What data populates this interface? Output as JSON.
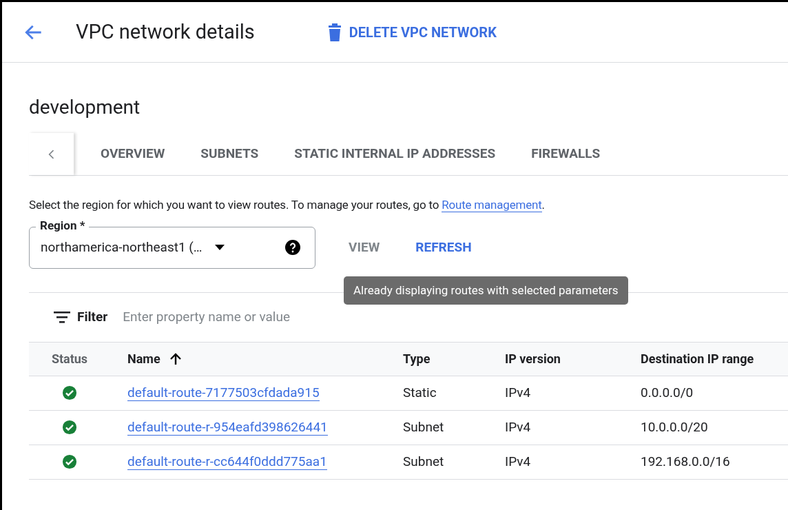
{
  "header": {
    "title": "VPC network details",
    "delete_button": "DELETE VPC NETWORK"
  },
  "network_name": "development",
  "tabs": [
    {
      "label": "OVERVIEW",
      "selected": false
    },
    {
      "label": "SUBNETS",
      "selected": false
    },
    {
      "label": "STATIC INTERNAL IP ADDRESSES",
      "selected": false
    },
    {
      "label": "FIREWALLS",
      "selected": false
    }
  ],
  "intro": {
    "text": "Select the region for which you want to view routes. To manage your routes, go to",
    "link": "Route management",
    "after": "."
  },
  "region": {
    "label": "Region *",
    "value": "northamerica-northeast1 (…"
  },
  "actions": [
    {
      "label": "VIEW",
      "disabled": true
    },
    {
      "label": "REFRESH",
      "disabled": false
    }
  ],
  "tooltip": "Already displaying routes with selected parameters",
  "filter": {
    "label": "Filter",
    "placeholder": "Enter property name or value"
  },
  "table": {
    "columns": [
      {
        "label": "Status",
        "sortable": false,
        "sorted_ascending": false
      },
      {
        "label": "Name",
        "sortable": true,
        "sorted_ascending": true
      },
      {
        "label": "Type",
        "sortable": true,
        "sorted_ascending": false
      },
      {
        "label": "IP version",
        "sortable": true,
        "sorted_ascending": false
      },
      {
        "label": "Destination IP range",
        "sortable": true,
        "sorted_ascending": false
      }
    ],
    "rows": [
      {
        "healthy": true,
        "name": "default-route-7177503cfdada915",
        "type": "Static",
        "ip_version": "IPv4",
        "destination": "0.0.0.0/0"
      },
      {
        "healthy": true,
        "name": "default-route-r-954eafd398626441",
        "type": "Subnet",
        "ip_version": "IPv4",
        "destination": "10.0.0.0/20"
      },
      {
        "healthy": true,
        "name": "default-route-r-cc644f0ddd775aa1",
        "type": "Subnet",
        "ip_version": "IPv4",
        "destination": "192.168.0.0/16"
      }
    ]
  }
}
